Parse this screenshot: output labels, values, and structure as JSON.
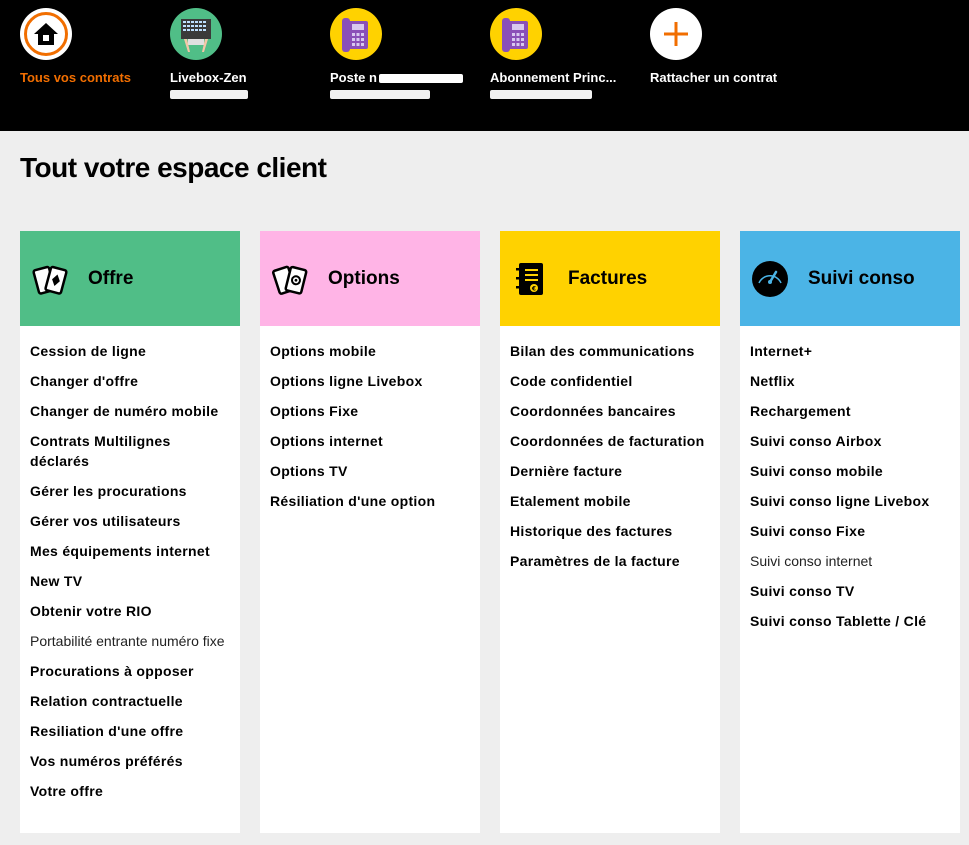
{
  "colors": {
    "accent_orange": "#f16e00",
    "offre": "#50be87",
    "options": "#ffb4e6",
    "factures": "#ffd200",
    "suivi": "#4bb4e6"
  },
  "contracts": [
    {
      "label": "Tous vos contrats",
      "icon": "home-icon",
      "active": true
    },
    {
      "label": "Livebox-Zen",
      "icon": "livebox-icon",
      "active": false
    },
    {
      "label": "Poste n",
      "icon": "phone-icon",
      "active": false
    },
    {
      "label": "Abonnement Princ...",
      "icon": "phone-icon",
      "active": false
    },
    {
      "label": "Rattacher un contrat",
      "icon": "plus-icon",
      "active": false
    }
  ],
  "page_title": "Tout votre espace client",
  "cards": [
    {
      "title": "Offre",
      "icon": "cards-icon",
      "items": [
        {
          "label": "Cession de ligne"
        },
        {
          "label": "Changer d'offre"
        },
        {
          "label": "Changer de numéro mobile"
        },
        {
          "label": "Contrats Multilignes déclarés"
        },
        {
          "label": "Gérer les procurations"
        },
        {
          "label": "Gérer vos utilisateurs"
        },
        {
          "label": "Mes équipements internet"
        },
        {
          "label": "New TV"
        },
        {
          "label": "Obtenir votre RIO"
        },
        {
          "label": "Portabilité entrante numéro fixe"
        },
        {
          "label": "Procurations à opposer"
        },
        {
          "label": "Relation contractuelle"
        },
        {
          "label": "Resiliation d'une offre"
        },
        {
          "label": "Vos numéros préférés"
        },
        {
          "label": "Votre offre"
        }
      ]
    },
    {
      "title": "Options",
      "icon": "options-cards-icon",
      "items": [
        {
          "label": "Options mobile"
        },
        {
          "label": "Options ligne Livebox"
        },
        {
          "label": "Options Fixe"
        },
        {
          "label": "Options internet"
        },
        {
          "label": "Options TV"
        },
        {
          "label": "Résiliation d'une option"
        }
      ]
    },
    {
      "title": "Factures",
      "icon": "invoice-icon",
      "items": [
        {
          "label": "Bilan des communications"
        },
        {
          "label": "Code confidentiel"
        },
        {
          "label": "Coordonnées bancaires"
        },
        {
          "label": "Coordonnées de facturation"
        },
        {
          "label": "Dernière facture"
        },
        {
          "label": "Etalement mobile"
        },
        {
          "label": "Historique des factures"
        },
        {
          "label": "Paramètres de la facture"
        }
      ]
    },
    {
      "title": "Suivi conso",
      "icon": "gauge-icon",
      "items": [
        {
          "label": "Internet+"
        },
        {
          "label": "Netflix"
        },
        {
          "label": "Rechargement"
        },
        {
          "label": "Suivi conso Airbox"
        },
        {
          "label": "Suivi conso mobile"
        },
        {
          "label": "Suivi conso ligne Livebox"
        },
        {
          "label": "Suivi conso Fixe"
        },
        {
          "label": "Suivi conso internet"
        },
        {
          "label": "Suivi conso TV"
        },
        {
          "label": "Suivi conso Tablette / Clé"
        }
      ]
    }
  ]
}
